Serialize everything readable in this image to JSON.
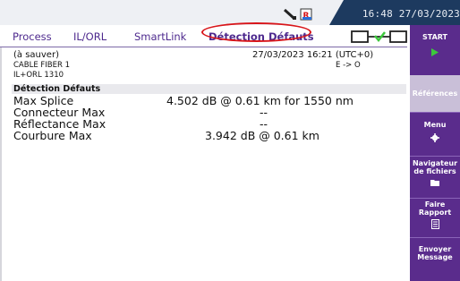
{
  "status_bar": {
    "time": "16:48 27/03/2023"
  },
  "tabs": [
    {
      "label": "Process"
    },
    {
      "label": "IL/ORL"
    },
    {
      "label": "SmartLink"
    },
    {
      "label": "Détection Défauts"
    }
  ],
  "header": {
    "line1": "(à sauver)",
    "timestamp": "27/03/2023 16:21 (UTC+0)",
    "line2": "CABLE FIBER 1",
    "direction": "E -> O",
    "line3": "IL+ORL 1310"
  },
  "section": {
    "title": "Détection Défauts"
  },
  "results": [
    {
      "label": "Max Splice",
      "value": "4.502 dB   @ 0.61 km   for 1550 nm"
    },
    {
      "label": "Connecteur Max",
      "value": "--"
    },
    {
      "label": "Réflectance Max",
      "value": "--"
    },
    {
      "label": "Courbure Max",
      "value": "3.942 dB   @ 0.61 km"
    }
  ],
  "sidebar": {
    "start": "START",
    "references": "Références",
    "menu": "Menu",
    "file_nav_1": "Navigateur",
    "file_nav_2": "de fichiers",
    "report_1": "Faire",
    "report_2": "Rapport",
    "send_1": "Envoyer",
    "send_2": "Message"
  },
  "colors": {
    "tab_text": "#4e2a8e",
    "active_highlight": "#d8151a",
    "sidebar_bg": "#5a2c8c",
    "start_arrow": "#3cc83c"
  }
}
